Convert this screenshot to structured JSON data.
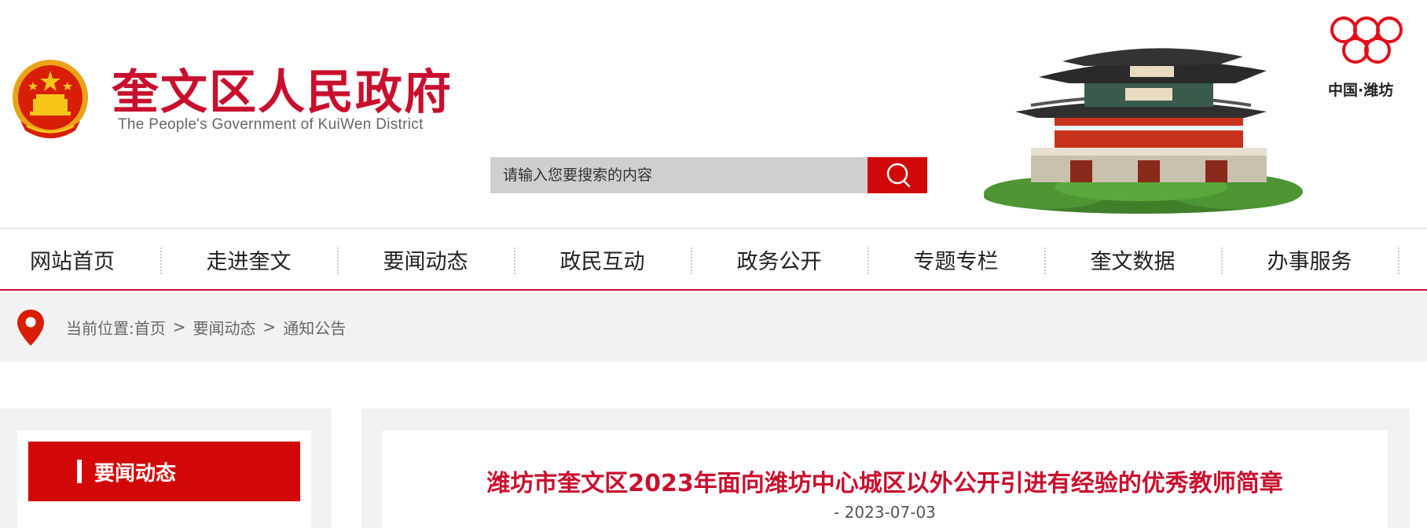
{
  "header": {
    "title": "奎文区人民政府",
    "subtitle": "The People's Government of KuiWen District",
    "emblem_icon": "national-emblem-icon",
    "city_logo_icon": "city-rings-logo-icon",
    "city_name": "中国·潍坊",
    "brand_color": "#c8102e"
  },
  "search": {
    "placeholder": "请输入您要搜索的内容",
    "button_icon": "search-icon",
    "button_color": "#d20808"
  },
  "nav": {
    "items": [
      {
        "label": "网站首页"
      },
      {
        "label": "走进奎文"
      },
      {
        "label": "要闻动态"
      },
      {
        "label": "政民互动"
      },
      {
        "label": "政务公开"
      },
      {
        "label": "专题专栏"
      },
      {
        "label": "奎文数据"
      },
      {
        "label": "办事服务"
      }
    ]
  },
  "breadcrumb": {
    "icon": "location-pin-icon",
    "prefix": "当前位置:",
    "items": [
      "首页",
      "要闻动态",
      "通知公告"
    ],
    "separator": ">"
  },
  "sidebar": {
    "heading": "要闻动态"
  },
  "article": {
    "title": "潍坊市奎文区2023年面向潍坊中心城区以外公开引进有经验的优秀教师简章",
    "date": "- 2023-07-03"
  }
}
